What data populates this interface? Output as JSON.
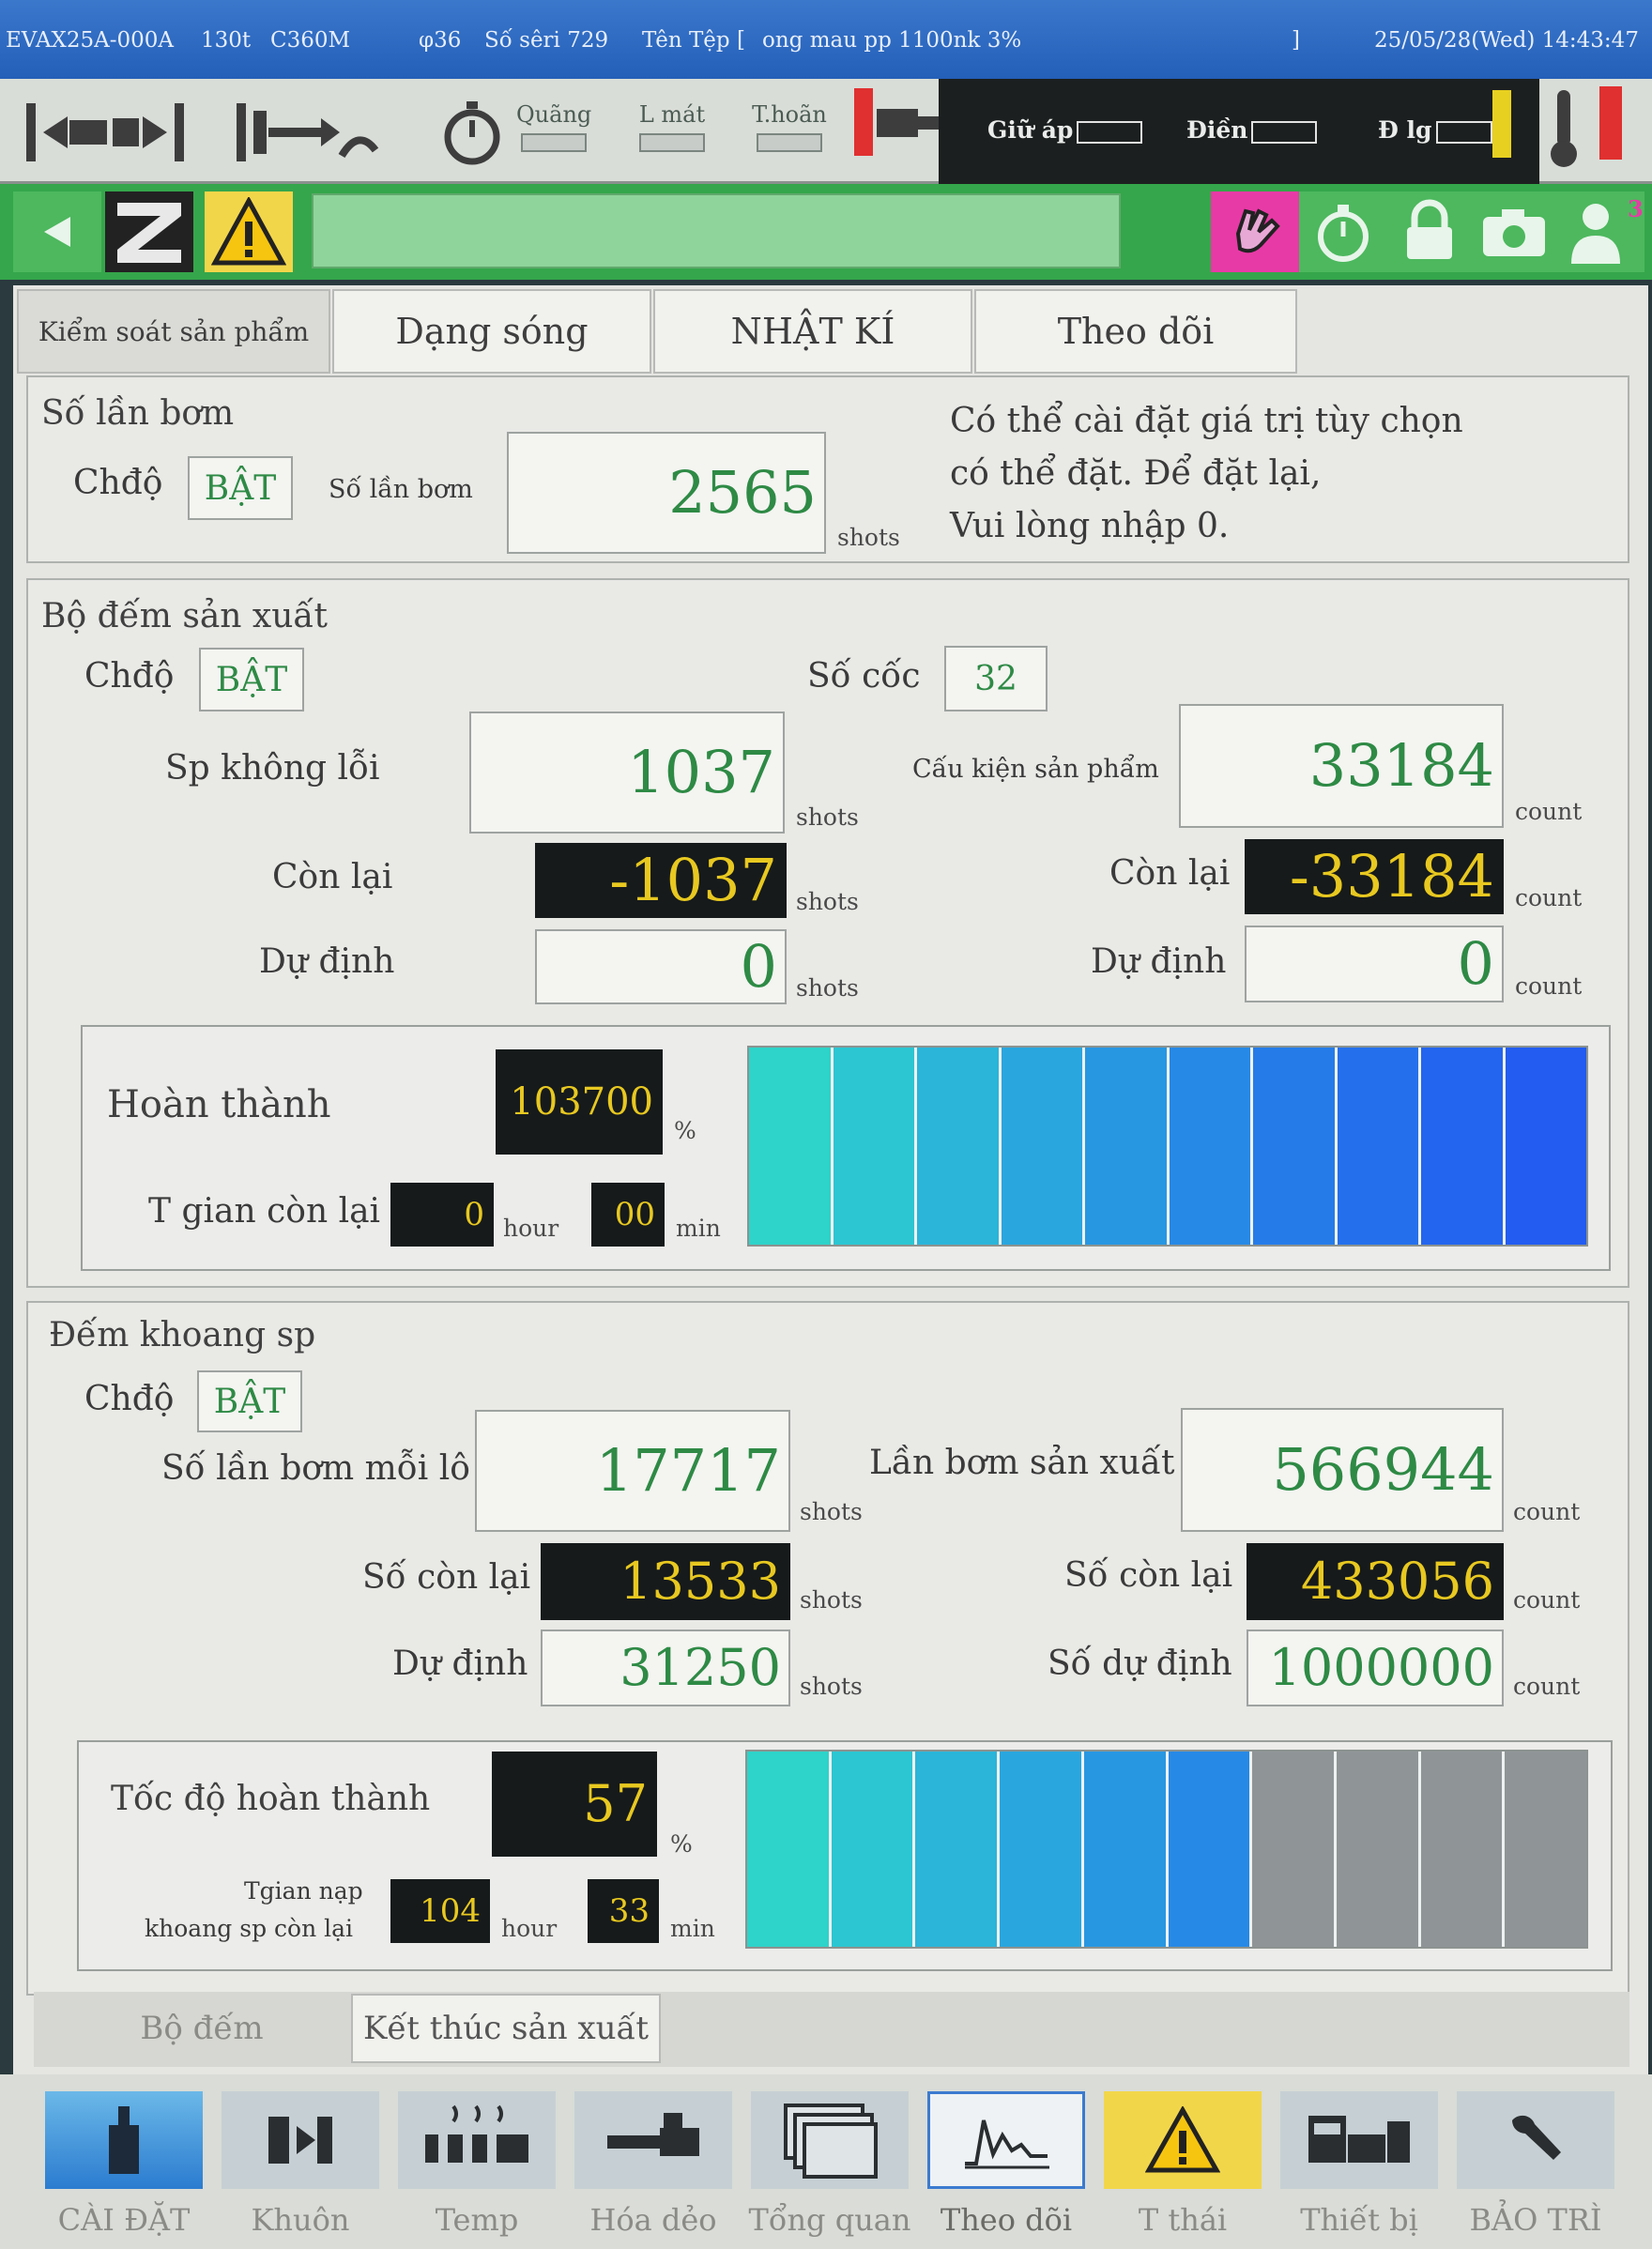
{
  "status_bar": {
    "model": "EVAX25A-000A",
    "tonnage": "130t",
    "unit_type": "C360M",
    "screw": "φ36",
    "serial": "Số sêri 729",
    "file_label": "Tên Tệp [",
    "file_name": "ong mau pp 1100nk 3%",
    "file_close": "]",
    "datetime": "25/05/28(Wed) 14:43:47"
  },
  "toolbar": {
    "quang_label": "Quãng",
    "lmat_label": "L mát",
    "thoan_label": "T.hoãn",
    "giuap_label": "Giữ áp",
    "dien_label": "Điền",
    "dlg_label": "Đ lg"
  },
  "greenbar": {
    "counter_badge": "3"
  },
  "tabs": [
    {
      "label": "Kiểm soát sản phẩm"
    },
    {
      "label": "Dạng sóng"
    },
    {
      "label": "NHẬT KÍ"
    },
    {
      "label": "Theo dõi"
    }
  ],
  "injection": {
    "title": "Số lần bơm",
    "mode_label": "Chđộ",
    "mode_value": "BẬT",
    "count_label": "Số lần bơm",
    "count_value": "2565",
    "count_unit": "shots",
    "note_lines": [
      "Có thể cài đặt giá trị tùy chọn",
      "có thể đặt. Để đặt lại,",
      "Vui lòng nhập 0."
    ]
  },
  "production": {
    "title": "Bộ đếm sản xuất",
    "mode_label": "Chđộ",
    "mode_value": "BẬT",
    "cavity_label": "Số cốc",
    "cavity_value": "32",
    "good_label": "Sp không lỗi",
    "good_value": "1037",
    "good_unit": "shots",
    "part_label": "Cấu kiện sản phẩm",
    "part_value": "33184",
    "part_unit": "count",
    "remain_label": "Còn lại",
    "remain_value": "-1037",
    "remain_unit": "shots",
    "part_remain_label": "Còn lại",
    "part_remain_value": "-33184",
    "part_remain_unit": "count",
    "plan_label": "Dự định",
    "plan_value": "0",
    "plan_unit": "shots",
    "part_plan_label": "Dự định",
    "part_plan_value": "0",
    "part_plan_unit": "count",
    "completion_label": "Hoàn thành",
    "completion_value": "103700",
    "completion_unit": "%",
    "completion_pct": 100,
    "time_label": "T gian còn lại",
    "hours_value": "0",
    "hours_unit": "hour",
    "minutes_value": "00",
    "minutes_unit": "min"
  },
  "cavity_count": {
    "title": "Đếm khoang sp",
    "mode_label": "Chđộ",
    "mode_value": "BẬT",
    "per_lot_label": "Số lần bơm mỗi lô",
    "per_lot_value": "17717",
    "per_lot_unit": "shots",
    "prod_shots_label": "Lần bơm sản xuất",
    "prod_shots_value": "566944",
    "prod_shots_unit": "count",
    "remain_label": "Số còn lại",
    "remain_value": "13533",
    "remain_unit": "shots",
    "prod_remain_label": "Số còn lại",
    "prod_remain_value": "433056",
    "prod_remain_unit": "count",
    "plan_label": "Dự định",
    "plan_value": "31250",
    "plan_unit": "shots",
    "prod_plan_label": "Số dự định",
    "prod_plan_value": "1000000",
    "prod_plan_unit": "count",
    "speed_label": "Tốc độ hoàn thành",
    "speed_value": "57",
    "speed_unit": "%",
    "speed_pct": 57,
    "time_label_1": "Tgian nạp",
    "time_label_2": "khoang sp còn lại",
    "hours_value": "104",
    "hours_unit": "hour",
    "minutes_value": "33",
    "minutes_unit": "min"
  },
  "subtabs": [
    {
      "label": "Bộ đếm"
    },
    {
      "label": "Kết thúc sản xuất"
    }
  ],
  "bottom_nav": [
    {
      "label": "CÀI ĐẶT",
      "icon": "setup-icon"
    },
    {
      "label": "Khuôn",
      "icon": "mold-icon"
    },
    {
      "label": "Temp",
      "icon": "temperature-icon"
    },
    {
      "label": "Hóa dẻo",
      "icon": "plasticize-icon"
    },
    {
      "label": "Tổng quan",
      "icon": "overview-icon"
    },
    {
      "label": "Theo dõi",
      "icon": "monitor-icon"
    },
    {
      "label": "T thái",
      "icon": "warning-icon"
    },
    {
      "label": "Thiết bị",
      "icon": "equipment-icon"
    },
    {
      "label": "BẢO TRÌ",
      "icon": "wrench-icon"
    }
  ],
  "colors": {
    "accent_green": "#35a64b",
    "value_green": "#2e8a45",
    "value_yellow": "#e8c820",
    "status_blue": "#2f6cc3",
    "magenta": "#e83aa6",
    "bar_gray": "#8f9597"
  }
}
